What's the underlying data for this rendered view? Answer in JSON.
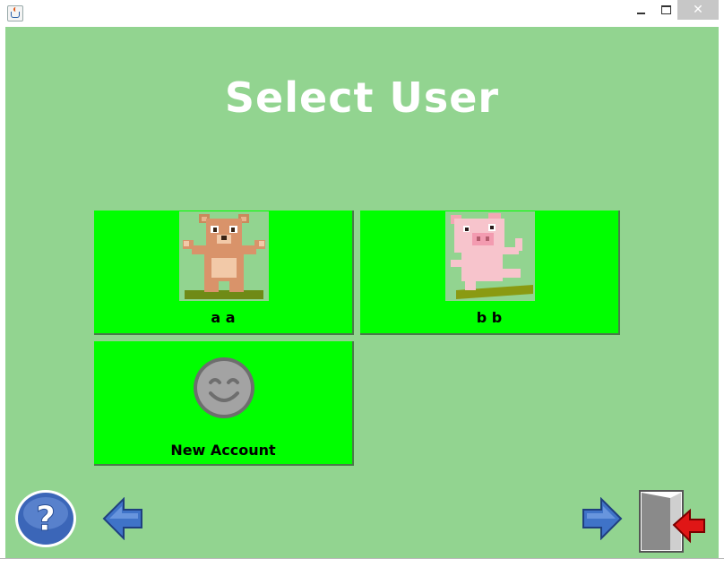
{
  "window": {
    "title": "",
    "close_glyph": "✕"
  },
  "page": {
    "title": "Select User"
  },
  "users": [
    {
      "name": "a a",
      "avatar": "bear-icon"
    },
    {
      "name": "b b",
      "avatar": "pig-icon"
    }
  ],
  "new_account": {
    "label": "New Account",
    "icon": "smiley-face-icon"
  },
  "nav": {
    "help_icon": "help-question-icon",
    "back_icon": "arrow-left-icon",
    "forward_icon": "arrow-right-icon",
    "exit_icon": "exit-door-icon",
    "help_glyph": "?"
  },
  "colors": {
    "background": "#92d490",
    "tile": "#00ff00",
    "title_text": "#ffffff",
    "arrow_blue": "#3f73c8",
    "exit_arrow": "#e01616"
  }
}
